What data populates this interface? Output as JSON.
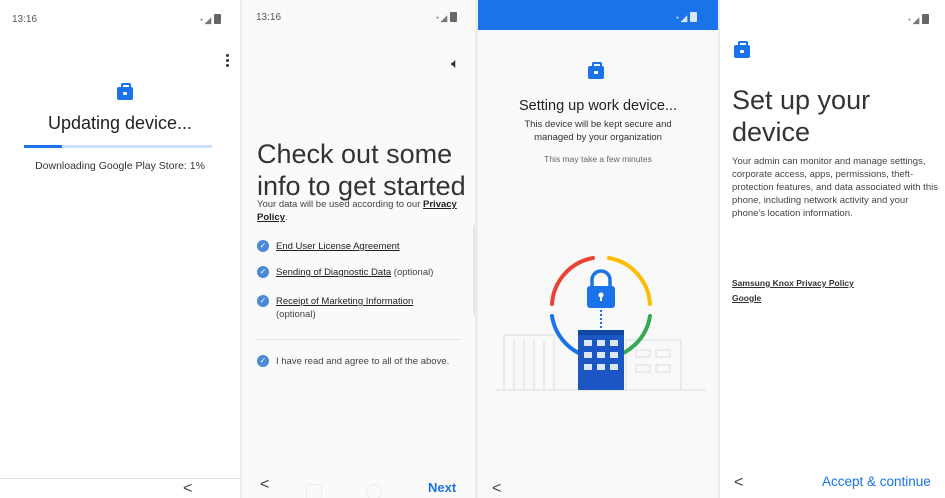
{
  "screen1": {
    "time": "13:16",
    "title": "Updating device...",
    "progress_label": "Downloading Google Play Store: 1%",
    "progress_fraction": 0.01,
    "back": "<"
  },
  "screen2": {
    "time": "13:16",
    "heading": "Check out some info to get started",
    "privacy_prefix": "Your data will be used according to our ",
    "privacy_link": "Privacy Policy",
    "privacy_suffix": ".",
    "items": [
      {
        "link": "End User License Agreement",
        "suffix": ""
      },
      {
        "link": "Sending of Diagnostic Data",
        "suffix": " (optional)"
      },
      {
        "link": "Receipt of Marketing Information",
        "suffix": "(optional)"
      }
    ],
    "agree_all": "I have read and agree to all of the above.",
    "back": "<",
    "next": "Next"
  },
  "screen3": {
    "heading": "Setting up work device...",
    "sub": "This device will be kept secure and managed by your organization",
    "note": "This may take a few minutes",
    "back": "<"
  },
  "screen4": {
    "heading": "Set up your device",
    "body": "Your admin can monitor and manage settings, corporate access, apps, permissions, theft-protection features, and data associated with this phone, including network activity and your phone's location information.",
    "link1": "Samsung Knox Privacy Policy",
    "link2": "Google",
    "back": "<",
    "accept": "Accept & continue"
  },
  "colors": {
    "accent": "#1a73e8",
    "google_red": "#ea4335",
    "google_yellow": "#fbbc04",
    "google_green": "#34a853"
  },
  "icons": [
    "briefcase-icon",
    "overflow-menu-icon",
    "speaker-icon",
    "check-circle-icon",
    "lock-icon",
    "back-arrow-icon",
    "wifi-signal-icon",
    "battery-icon"
  ]
}
